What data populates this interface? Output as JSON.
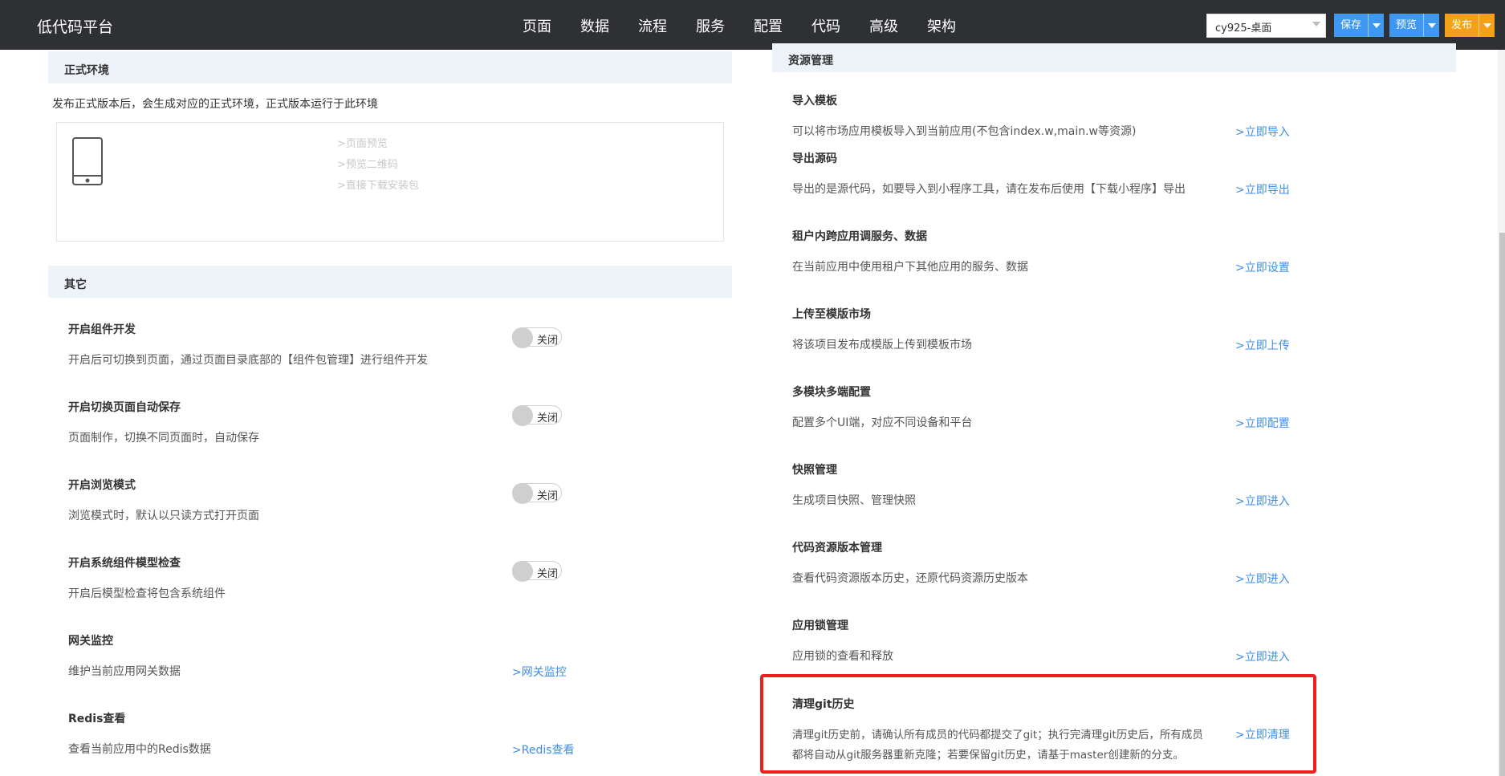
{
  "header": {
    "app_title": "低代码平台",
    "nav": [
      "页面",
      "数据",
      "流程",
      "服务",
      "配置",
      "代码",
      "高级",
      "架构"
    ],
    "active_nav": "高级",
    "env_select": "cy925-桌面",
    "save_label": "保存",
    "preview_label": "预览",
    "publish_label": "发布"
  },
  "prod_env": {
    "title": "正式环境",
    "description": "发布正式版本后，会生成对应的正式环境，正式版本运行于此环境",
    "links": [
      ">页面预览",
      ">预览二维码",
      ">直接下载安装包"
    ]
  },
  "other": {
    "title": "其它",
    "rows": [
      {
        "title": "开启组件开发",
        "desc": "开启后可切换到页面，通过页面目录底部的【组件包管理】进行组件开发",
        "toggle": "关闭"
      },
      {
        "title": "开启切换页面自动保存",
        "desc": "页面制作，切换不同页面时，自动保存",
        "toggle": "关闭"
      },
      {
        "title": "开启浏览模式",
        "desc": "浏览模式时，默认以只读方式打开页面",
        "toggle": "关闭"
      },
      {
        "title": "开启系统组件模型检查",
        "desc": "开启后模型检查将包含系统组件",
        "toggle": "关闭"
      },
      {
        "title": "网关监控",
        "desc": "维护当前应用网关数据",
        "link": ">网关监控"
      },
      {
        "title": "Redis查看",
        "desc": "查看当前应用中的Redis数据",
        "link": ">Redis查看"
      }
    ]
  },
  "resources": {
    "title": "资源管理",
    "rows": [
      {
        "title": "导入模板",
        "desc": "可以将市场应用模板导入到当前应用(不包含index.w,main.w等资源)",
        "link": ">立即导入"
      },
      {
        "title": "导出源码",
        "desc": "导出的是源代码，如要导入到小程序工具，请在发布后使用【下载小程序】导出",
        "link": ">立即导出"
      },
      {
        "title": "租户内跨应用调服务、数据",
        "desc": "在当前应用中使用租户下其他应用的服务、数据",
        "link": ">立即设置"
      },
      {
        "title": "上传至模版市场",
        "desc": "将该项目发布成模版上传到模板市场",
        "link": ">立即上传"
      },
      {
        "title": "多模块多端配置",
        "desc": "配置多个UI端，对应不同设备和平台",
        "link": ">立即配置"
      },
      {
        "title": "快照管理",
        "desc": "生成项目快照、管理快照",
        "link": ">立即进入"
      },
      {
        "title": "代码资源版本管理",
        "desc": "查看代码资源版本历史，还原代码资源历史版本",
        "link": ">立即进入"
      },
      {
        "title": "应用锁管理",
        "desc": "应用锁的查看和释放",
        "link": ">立即进入"
      }
    ],
    "git": {
      "title": "清理git历史",
      "desc_line1": "清理git历史前，请确认所有成员的代码都提交了git；执行完清理git历史后，所有成员",
      "desc_line2": "都将自动从git服务器重新克隆；若要保留git历史，请基于master创建新的分支。",
      "link": ">立即清理"
    }
  }
}
